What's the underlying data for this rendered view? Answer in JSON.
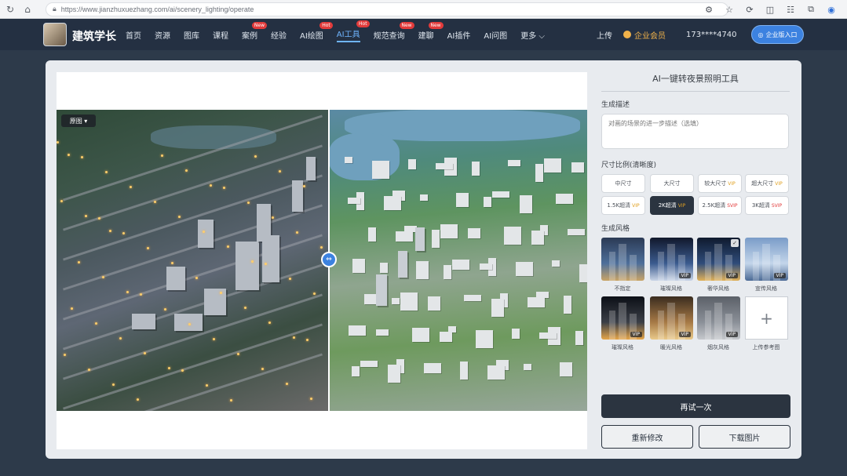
{
  "browser": {
    "url": "https://www.jianzhuxuezhang.com/ai/scenery_lighting/operate"
  },
  "site": {
    "brand": "建筑学长",
    "nav": [
      {
        "label": "首页",
        "badge": ""
      },
      {
        "label": "资源",
        "badge": ""
      },
      {
        "label": "图库",
        "badge": ""
      },
      {
        "label": "课程",
        "badge": ""
      },
      {
        "label": "案例",
        "badge": "New"
      },
      {
        "label": "经验",
        "badge": ""
      },
      {
        "label": "AI绘图",
        "badge": "Hot"
      },
      {
        "label": "AI工具",
        "badge": "Hot"
      },
      {
        "label": "规范查询",
        "badge": "New"
      },
      {
        "label": "建聊",
        "badge": "New"
      },
      {
        "label": "AI插件",
        "badge": ""
      },
      {
        "label": "AI问图",
        "badge": ""
      },
      {
        "label": "更多 ⌵",
        "badge": ""
      }
    ],
    "upload": "上传",
    "member": "企业会员",
    "phone": "173****4740",
    "enter_button": "企业版入口"
  },
  "compare": {
    "view_tag": "原图 ▾"
  },
  "panel": {
    "title": "AI一键转夜景照明工具",
    "desc_label": "生成描述",
    "desc_placeholder": "对画的场景的进一步描述（选填）",
    "size_label": "尺寸比例(清晰度)",
    "sizes": [
      {
        "label": "中尺寸",
        "vip": "",
        "selected": false
      },
      {
        "label": "大尺寸",
        "vip": "",
        "selected": false
      },
      {
        "label": "较大尺寸",
        "vip": "VIP",
        "selected": false
      },
      {
        "label": "超大尺寸",
        "vip": "VIP",
        "selected": false
      },
      {
        "label": "1.5K超清",
        "vip": "VIP",
        "selected": false
      },
      {
        "label": "2K超清",
        "vip": "VIP",
        "selected": true
      },
      {
        "label": "2.5K超清",
        "vip": "SVIP",
        "selected": false
      },
      {
        "label": "3K超清",
        "vip": "SVIP",
        "selected": false
      }
    ],
    "style_label": "生成风格",
    "styles": [
      {
        "label": "不指定",
        "vip": "",
        "checked": false,
        "colors": [
          "#2b3a55",
          "#4e6f9a",
          "#c9a467"
        ]
      },
      {
        "label": "璀璨风格",
        "vip": "VIP",
        "checked": false,
        "colors": [
          "#11182b",
          "#3b5b8f",
          "#c9d4e6"
        ]
      },
      {
        "label": "奢华风格",
        "vip": "VIP",
        "checked": true,
        "colors": [
          "#0f1a2e",
          "#2f4c7a",
          "#e0b15a"
        ]
      },
      {
        "label": "宣传风格",
        "vip": "VIP",
        "checked": false,
        "colors": [
          "#7a9cc8",
          "#c3d5ea",
          "#4b6a95"
        ]
      },
      {
        "label": "璀璨风格",
        "vip": "VIP",
        "checked": false,
        "colors": [
          "#0c0f16",
          "#3b3f47",
          "#e6a64a"
        ]
      },
      {
        "label": "暖光风格",
        "vip": "VIP",
        "checked": false,
        "colors": [
          "#3a2c1f",
          "#a77a46",
          "#e9c98a"
        ]
      },
      {
        "label": "烟灰风格",
        "vip": "VIP",
        "checked": false,
        "colors": [
          "#5b6068",
          "#8b9098",
          "#c5c8cc"
        ]
      }
    ],
    "upload_ref": "上传参考图",
    "try_button": "再试一次",
    "modify_button": "重新修改",
    "download_button": "下载图片"
  }
}
